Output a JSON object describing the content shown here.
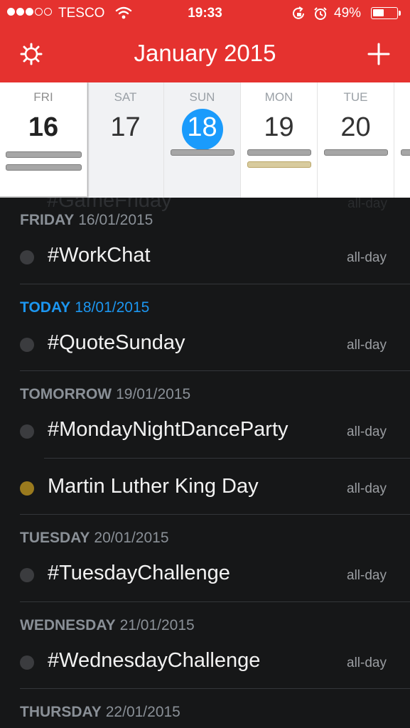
{
  "status_bar": {
    "carrier": "TESCO",
    "time": "19:33",
    "battery_percent": "49%",
    "battery_level": 0.49,
    "signal_bars_filled": 3,
    "signal_bars_total": 5,
    "icons": [
      "wifi-icon",
      "rotation-lock-icon",
      "alarm-icon",
      "battery-icon"
    ]
  },
  "nav": {
    "title": "January 2015",
    "left_icon": "gear-icon",
    "right_icon": "plus-icon"
  },
  "week": {
    "days": [
      {
        "name": "FRI",
        "num": "16"
      },
      {
        "name": "SAT",
        "num": "17"
      },
      {
        "name": "SUN",
        "num": "18"
      },
      {
        "name": "MON",
        "num": "19"
      },
      {
        "name": "TUE",
        "num": "20"
      }
    ]
  },
  "agenda": {
    "ghost_title": "#GameFriday",
    "ghost_allday": "all-day",
    "sections": [
      {
        "label": "FRIDAY",
        "date": "16/01/2015",
        "events": [
          {
            "title": "#WorkChat",
            "time": "all-day"
          }
        ]
      },
      {
        "label": "TODAY",
        "date": "18/01/2015",
        "events": [
          {
            "title": "#QuoteSunday",
            "time": "all-day"
          }
        ]
      },
      {
        "label": "TOMORROW",
        "date": "19/01/2015",
        "events": [
          {
            "title": "#MondayNightDanceParty",
            "time": "all-day"
          },
          {
            "title": "Martin Luther King Day",
            "time": "all-day"
          }
        ]
      },
      {
        "label": "TUESDAY",
        "date": "20/01/2015",
        "events": [
          {
            "title": "#TuesdayChallenge",
            "time": "all-day"
          }
        ]
      },
      {
        "label": "WEDNESDAY",
        "date": "21/01/2015",
        "events": [
          {
            "title": "#WednesdayChallenge",
            "time": "all-day"
          }
        ]
      },
      {
        "label": "THURSDAY",
        "date": "22/01/2015",
        "events": []
      }
    ]
  },
  "colors": {
    "header_red": "#E5322F",
    "today_blue": "#1A9BFC",
    "holiday_gold": "#9a7a1e",
    "list_background": "#161718"
  }
}
